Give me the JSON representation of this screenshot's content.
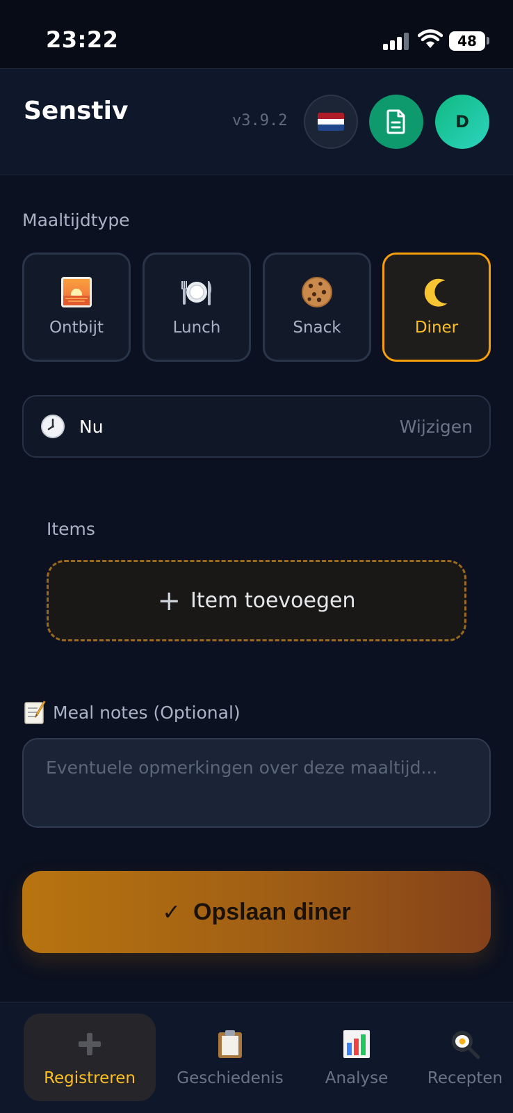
{
  "status_bar": {
    "time": "23:22",
    "battery": "48"
  },
  "header": {
    "title": "Senstiv",
    "version": "v3.9.2",
    "language_flag": "nl-flag-icon",
    "avatar_initial": "D"
  },
  "meal_type": {
    "label": "Maaltijdtype",
    "options": [
      {
        "label": "Ontbijt",
        "icon": "sunrise-icon",
        "selected": false
      },
      {
        "label": "Lunch",
        "icon": "plate-cutlery-icon",
        "selected": false
      },
      {
        "label": "Snack",
        "icon": "cookie-icon",
        "selected": false
      },
      {
        "label": "Diner",
        "icon": "moon-icon",
        "selected": true
      }
    ]
  },
  "time": {
    "value": "Nu",
    "change_label": "Wijzigen"
  },
  "items": {
    "label": "Items",
    "add_label": "Item toevoegen"
  },
  "notes": {
    "label": "Meal notes (Optional)",
    "placeholder": "Eventuele opmerkingen over deze maaltijd...",
    "value": ""
  },
  "save": {
    "label": "Opslaan diner"
  },
  "nav": {
    "items": [
      {
        "label": "Registreren",
        "icon": "plus-icon",
        "active": true
      },
      {
        "label": "Geschiedenis",
        "icon": "clipboard-icon",
        "active": false
      },
      {
        "label": "Analyse",
        "icon": "bar-chart-icon",
        "active": false
      },
      {
        "label": "Recepten",
        "icon": "frying-pan-icon",
        "active": false
      }
    ]
  },
  "colors": {
    "accent": "#f59e0b",
    "background": "#0b1120",
    "avatar": "#10b981"
  }
}
